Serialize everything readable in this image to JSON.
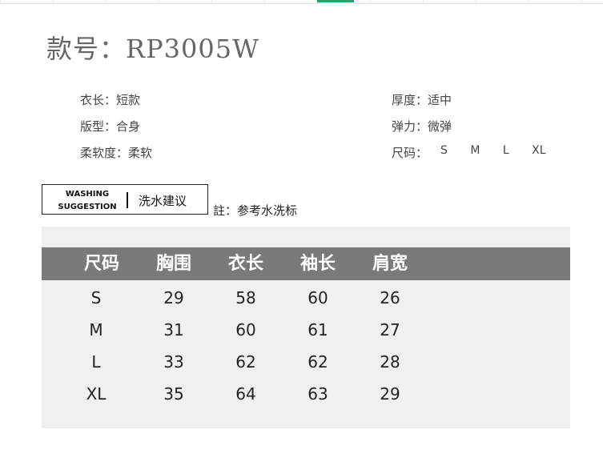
{
  "title": "款号：RP3005W",
  "attributes": {
    "length": "衣长：短款",
    "fit": "版型：合身",
    "softness": "柔软度：柔软",
    "thickness": "厚度：适中",
    "elasticity": "弹力：微弹",
    "size_label": "尺码：",
    "sizes": [
      "S",
      "M",
      "L",
      "XL"
    ]
  },
  "washing": {
    "en_line1": "WASHING",
    "en_line2": "SUGGESTION",
    "cn": "洗水建议",
    "note": "註：参考水洗标"
  },
  "table": {
    "headers": [
      "尺码",
      "胸围",
      "衣长",
      "袖长",
      "肩宽"
    ],
    "rows": [
      [
        "S",
        "29",
        "58",
        "60",
        "26"
      ],
      [
        "M",
        "31",
        "60",
        "61",
        "27"
      ],
      [
        "L",
        "33",
        "62",
        "62",
        "28"
      ],
      [
        "XL",
        "35",
        "64",
        "63",
        "29"
      ]
    ]
  },
  "colors": {
    "header_bg": "#7a7a7a",
    "table_bg": "#f0f0f0",
    "selection": "#21a366"
  }
}
